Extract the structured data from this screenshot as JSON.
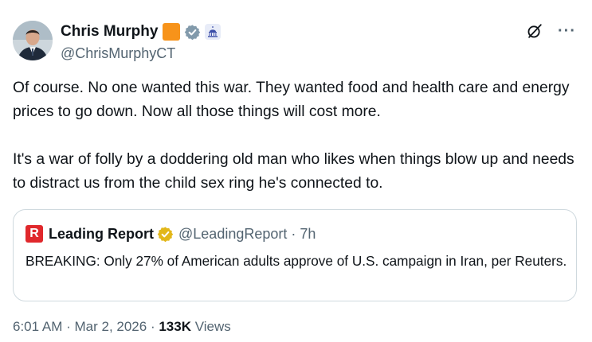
{
  "author": {
    "display_name": "Chris Murphy",
    "handle": "@ChrisMurphyCT",
    "badges": [
      "orange-square-badge",
      "verified-gray-check-icon",
      "capitol-building-icon"
    ]
  },
  "header_actions": {
    "icons": [
      "grok-icon",
      "more-icon"
    ],
    "more_label": "···"
  },
  "tweet": {
    "paragraphs": [
      "Of course. No one wanted this war. They wanted food and health care and energy prices to go down. Now all those things will cost more.",
      "It's a war of folly by a doddering old man who likes when things blow up and needs to distract us from the child sex ring he's connected to."
    ]
  },
  "quote": {
    "logo_letter": "R",
    "display_name": "Leading Report",
    "handle_time": "@LeadingReport · 7h",
    "text": "BREAKING: Only 27% of American adults approve of U.S. campaign in Iran, per Reuters."
  },
  "meta": {
    "time": "6:01 AM",
    "sep1": " · ",
    "date": "Mar 2, 2026",
    "sep2": " · ",
    "views_count": "133K",
    "views_label": " Views"
  },
  "colors": {
    "text": "#0f1419",
    "secondary": "#536471",
    "border": "#cfd9de",
    "gold_check": "#e2b719",
    "gray_check": "#829aab",
    "orange_badge": "#f7931a",
    "leading_report_red": "#e0282c"
  }
}
